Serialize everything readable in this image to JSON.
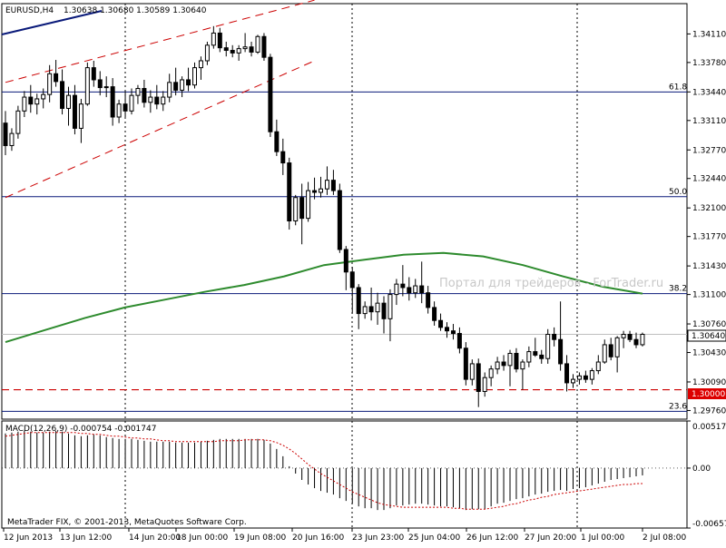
{
  "header": {
    "symbol_timeframe": "EURUSD,H4",
    "ohlc": "1.30638 1.30680 1.30589 1.30640"
  },
  "colors": {
    "background": "#ffffff",
    "grid": "#000000",
    "bull_candle": "#ffffff",
    "bear_candle": "#000000",
    "moving_average": "#2e8b2e",
    "trend_lines": "#cc0000",
    "support_line": "#cc0000",
    "trendline_upper": "#0a1a7a",
    "current_price_label_bg": "#ffffff",
    "level_label_bg": "#dd0000",
    "macd_signal": "#cc0000"
  },
  "watermark": "Портал для трейдеров - ForTrader.ru",
  "copyright": "MetaTrader FIX, © 2001-2013, MetaQuotes Software Corp.",
  "current_price_label": "1.30640",
  "support_level_label": "1.30000",
  "chart_data": [
    {
      "type": "candlestick",
      "title": "EURUSD,H4",
      "y_axis_ticks": [
        "1.34110",
        "1.33780",
        "1.33440",
        "1.33110",
        "1.32770",
        "1.32440",
        "1.32100",
        "1.31770",
        "1.31430",
        "1.31100",
        "1.30760",
        "1.30430",
        "1.30090",
        "1.29760"
      ],
      "ylim": [
        1.2966,
        1.3446
      ],
      "x_axis_ticks": [
        "12 Jun 2013",
        "13 Jun 12:00",
        "14 Jun 20:00",
        "18 Jun 00:00",
        "19 Jun 08:00",
        "20 Jun 16:00",
        "23 Jun 23:00",
        "25 Jun 04:00",
        "26 Jun 12:00",
        "27 Jun 20:00",
        "1 Jul 00:00",
        "2 Jul 08:00"
      ],
      "fibonacci_levels": [
        {
          "label": "61.8",
          "value": 1.3344
        },
        {
          "label": "50.0",
          "value": 1.3223
        },
        {
          "label": "38.2",
          "value": 1.3111
        },
        {
          "label": "23.6",
          "value": 1.2975
        }
      ],
      "horizontal_levels": [
        1.3,
        1.3064
      ],
      "candles": [
        [
          1.3308,
          1.3322,
          1.3271,
          1.3282
        ],
        [
          1.3282,
          1.3302,
          1.3276,
          1.3296
        ],
        [
          1.3296,
          1.3328,
          1.329,
          1.3322
        ],
        [
          1.3322,
          1.3345,
          1.3315,
          1.3338
        ],
        [
          1.3338,
          1.3352,
          1.332,
          1.333
        ],
        [
          1.333,
          1.3342,
          1.3318,
          1.3336
        ],
        [
          1.3336,
          1.3348,
          1.3325,
          1.3341
        ],
        [
          1.3341,
          1.3375,
          1.3332,
          1.3365
        ],
        [
          1.3365,
          1.3381,
          1.335,
          1.3356
        ],
        [
          1.3356,
          1.337,
          1.3318,
          1.3325
        ],
        [
          1.3325,
          1.335,
          1.3305,
          1.334
        ],
        [
          1.334,
          1.3352,
          1.3295,
          1.3302
        ],
        [
          1.3302,
          1.3336,
          1.3285,
          1.333
        ],
        [
          1.333,
          1.3378,
          1.3328,
          1.3372
        ],
        [
          1.3372,
          1.338,
          1.335,
          1.3358
        ],
        [
          1.3358,
          1.3368,
          1.334,
          1.3349
        ],
        [
          1.3349,
          1.3362,
          1.3338,
          1.335
        ],
        [
          1.335,
          1.336,
          1.3305,
          1.3315
        ],
        [
          1.3315,
          1.3335,
          1.3308,
          1.333
        ],
        [
          1.333,
          1.3345,
          1.3315,
          1.3322
        ],
        [
          1.3322,
          1.3348,
          1.3318,
          1.334
        ],
        [
          1.334,
          1.3352,
          1.333,
          1.3348
        ],
        [
          1.3348,
          1.3358,
          1.3326,
          1.3332
        ],
        [
          1.3332,
          1.3346,
          1.332,
          1.3338
        ],
        [
          1.3338,
          1.3352,
          1.3324,
          1.333
        ],
        [
          1.333,
          1.3345,
          1.3322,
          1.3338
        ],
        [
          1.3338,
          1.3365,
          1.3332,
          1.3355
        ],
        [
          1.3355,
          1.3372,
          1.334,
          1.3346
        ],
        [
          1.3346,
          1.3362,
          1.3338,
          1.3358
        ],
        [
          1.3358,
          1.3372,
          1.3345,
          1.3352
        ],
        [
          1.3352,
          1.3378,
          1.3348,
          1.3372
        ],
        [
          1.3372,
          1.3385,
          1.3358,
          1.338
        ],
        [
          1.338,
          1.3402,
          1.3375,
          1.3398
        ],
        [
          1.3398,
          1.342,
          1.3394,
          1.3412
        ],
        [
          1.3412,
          1.3418,
          1.339,
          1.3395
        ],
        [
          1.3395,
          1.3402,
          1.3385,
          1.3392
        ],
        [
          1.3392,
          1.3398,
          1.3384,
          1.3389
        ],
        [
          1.3389,
          1.3398,
          1.338,
          1.3394
        ],
        [
          1.3394,
          1.3412,
          1.339,
          1.3396
        ],
        [
          1.3396,
          1.3402,
          1.3385,
          1.339
        ],
        [
          1.339,
          1.341,
          1.3388,
          1.3408
        ],
        [
          1.3408,
          1.3412,
          1.338,
          1.3384
        ],
        [
          1.3384,
          1.3388,
          1.3292,
          1.3298
        ],
        [
          1.3298,
          1.3312,
          1.327,
          1.3275
        ],
        [
          1.3275,
          1.329,
          1.3248,
          1.3262
        ],
        [
          1.3262,
          1.3268,
          1.3185,
          1.3195
        ],
        [
          1.3195,
          1.3225,
          1.319,
          1.3222
        ],
        [
          1.3222,
          1.3238,
          1.3168,
          1.3198
        ],
        [
          1.3198,
          1.324,
          1.3194,
          1.323
        ],
        [
          1.323,
          1.3245,
          1.322,
          1.3228
        ],
        [
          1.3228,
          1.3246,
          1.3222,
          1.3232
        ],
        [
          1.3232,
          1.3258,
          1.3225,
          1.3242
        ],
        [
          1.3242,
          1.3254,
          1.3225,
          1.323
        ],
        [
          1.323,
          1.3238,
          1.3158,
          1.3162
        ],
        [
          1.3162,
          1.3166,
          1.3115,
          1.3136
        ],
        [
          1.3136,
          1.3142,
          1.3088,
          1.3118
        ],
        [
          1.3118,
          1.3122,
          1.307,
          1.3088
        ],
        [
          1.3088,
          1.3102,
          1.3082,
          1.3096
        ],
        [
          1.3096,
          1.3118,
          1.308,
          1.309
        ],
        [
          1.309,
          1.3112,
          1.3075,
          1.31
        ],
        [
          1.31,
          1.3108,
          1.3065,
          1.3082
        ],
        [
          1.3082,
          1.3116,
          1.3056,
          1.311
        ],
        [
          1.311,
          1.3128,
          1.3098,
          1.3122
        ],
        [
          1.3122,
          1.3144,
          1.3108,
          1.3118
        ],
        [
          1.3118,
          1.313,
          1.3103,
          1.3112
        ],
        [
          1.3112,
          1.3128,
          1.3106,
          1.312
        ],
        [
          1.312,
          1.3148,
          1.31,
          1.3112
        ],
        [
          1.3112,
          1.312,
          1.3088,
          1.3095
        ],
        [
          1.3095,
          1.3102,
          1.3074,
          1.308
        ],
        [
          1.308,
          1.3088,
          1.3068,
          1.3072
        ],
        [
          1.3072,
          1.3078,
          1.306,
          1.3068
        ],
        [
          1.3068,
          1.3076,
          1.3058,
          1.3065
        ],
        [
          1.3065,
          1.3072,
          1.3042,
          1.3048
        ],
        [
          1.3048,
          1.3055,
          1.3005,
          1.3012
        ],
        [
          1.3012,
          1.3035,
          1.3005,
          1.303
        ],
        [
          1.303,
          1.3036,
          1.298,
          1.2998
        ],
        [
          1.2998,
          1.302,
          1.2992,
          1.3014
        ],
        [
          1.3014,
          1.3028,
          1.3004,
          1.3024
        ],
        [
          1.3024,
          1.3038,
          1.3018,
          1.3032
        ],
        [
          1.3032,
          1.304,
          1.3022,
          1.3028
        ],
        [
          1.3028,
          1.3046,
          1.3004,
          1.3042
        ],
        [
          1.3042,
          1.3048,
          1.302,
          1.3024
        ],
        [
          1.3024,
          1.3035,
          1.3,
          1.3032
        ],
        [
          1.3032,
          1.305,
          1.3026,
          1.3044
        ],
        [
          1.3044,
          1.306,
          1.3038,
          1.304
        ],
        [
          1.304,
          1.3046,
          1.303,
          1.3036
        ],
        [
          1.3036,
          1.307,
          1.303,
          1.3064
        ],
        [
          1.3064,
          1.3072,
          1.305,
          1.3058
        ],
        [
          1.3058,
          1.3102,
          1.3022,
          1.303
        ],
        [
          1.303,
          1.304,
          1.2998,
          1.3008
        ],
        [
          1.3008,
          1.3018,
          1.3002,
          1.3012
        ],
        [
          1.3012,
          1.302,
          1.3006,
          1.3016
        ],
        [
          1.3016,
          1.3022,
          1.3008,
          1.3012
        ],
        [
          1.3012,
          1.3025,
          1.3006,
          1.3022
        ],
        [
          1.3022,
          1.304,
          1.3018,
          1.3032
        ],
        [
          1.3032,
          1.3058,
          1.303,
          1.3052
        ],
        [
          1.3052,
          1.306,
          1.3034,
          1.3038
        ],
        [
          1.3038,
          1.3062,
          1.302,
          1.306
        ],
        [
          1.306,
          1.3068,
          1.3048,
          1.3064
        ],
        [
          1.3064,
          1.3068,
          1.3055,
          1.3058
        ],
        [
          1.3058,
          1.3066,
          1.3048,
          1.3052
        ],
        [
          1.3052,
          1.3066,
          1.305,
          1.3064
        ]
      ],
      "moving_average": {
        "start_index": 0,
        "values": [
          1.3055,
          1.3069,
          1.3083,
          1.3095,
          1.3104,
          1.3113,
          1.3121,
          1.3131,
          1.3144,
          1.315,
          1.3156,
          1.3158,
          1.3154,
          1.3144,
          1.3131,
          1.3119,
          1.3111
        ]
      },
      "trend_lines": [
        {
          "style": "dashed",
          "from": [
            0,
            1.3355
          ],
          "to": [
            49,
            1.345
          ]
        },
        {
          "style": "dashed",
          "from": [
            0,
            1.3222
          ],
          "to": [
            49,
            1.338
          ]
        }
      ]
    },
    {
      "type": "bar",
      "title": "MACD(12,26,9) -0.000754 -0.001747",
      "y_axis_ticks": [
        "0.005171",
        "0.00",
        "-0.006575"
      ],
      "ylim": [
        -0.006575,
        0.005171
      ],
      "series": [
        {
          "name": "MACD",
          "values": [
            0.0038,
            0.0039,
            0.004,
            0.0041,
            0.004,
            0.0039,
            0.0039,
            0.004,
            0.0041,
            0.004,
            0.0038,
            0.0036,
            0.0035,
            0.0036,
            0.0037,
            0.0036,
            0.0034,
            0.0033,
            0.0032,
            0.0032,
            0.0032,
            0.0031,
            0.003,
            0.0029,
            0.0029,
            0.0029,
            0.0029,
            0.0028,
            0.0028,
            0.0028,
            0.0028,
            0.0029,
            0.003,
            0.0031,
            0.0032,
            0.0032,
            0.0032,
            0.0032,
            0.0032,
            0.0032,
            0.0032,
            0.0031,
            0.0027,
            0.0021,
            0.0013,
            0.0002,
            -0.0006,
            -0.0013,
            -0.0018,
            -0.0022,
            -0.0025,
            -0.0027,
            -0.0029,
            -0.0033,
            -0.0036,
            -0.0039,
            -0.0042,
            -0.0044,
            -0.0044,
            -0.0046,
            -0.0046,
            -0.0044,
            -0.0041,
            -0.0041,
            -0.004,
            -0.0039,
            -0.0039,
            -0.004,
            -0.0041,
            -0.0042,
            -0.0042,
            -0.0043,
            -0.0044,
            -0.0046,
            -0.0045,
            -0.0045,
            -0.0045,
            -0.0042,
            -0.0039,
            -0.0038,
            -0.0036,
            -0.0034,
            -0.0033,
            -0.0031,
            -0.0029,
            -0.0028,
            -0.0026,
            -0.0025,
            -0.0024,
            -0.0025,
            -0.0023,
            -0.0022,
            -0.0021,
            -0.0019,
            -0.0017,
            -0.0015,
            -0.0013,
            -0.0012,
            -0.0011,
            -0.001,
            -0.0009,
            -0.0008
          ]
        },
        {
          "name": "Signal",
          "values": [
            0.0035,
            0.0036,
            0.0037,
            0.0038,
            0.0039,
            0.0039,
            0.0039,
            0.0039,
            0.0039,
            0.0039,
            0.0039,
            0.0039,
            0.0038,
            0.0038,
            0.0037,
            0.0037,
            0.0036,
            0.0035,
            0.0035,
            0.0034,
            0.0033,
            0.0033,
            0.0032,
            0.0032,
            0.0031,
            0.003,
            0.003,
            0.0029,
            0.0029,
            0.0029,
            0.0029,
            0.0029,
            0.0029,
            0.0029,
            0.003,
            0.003,
            0.003,
            0.003,
            0.0031,
            0.0031,
            0.0031,
            0.0031,
            0.003,
            0.0028,
            0.0025,
            0.0021,
            0.0016,
            0.001,
            0.0004,
            -0.0001,
            -0.0006,
            -0.001,
            -0.0014,
            -0.0018,
            -0.0022,
            -0.0026,
            -0.0029,
            -0.0032,
            -0.0035,
            -0.0038,
            -0.004,
            -0.0041,
            -0.0042,
            -0.0043,
            -0.0043,
            -0.0043,
            -0.0043,
            -0.0043,
            -0.0043,
            -0.0043,
            -0.0043,
            -0.0044,
            -0.0044,
            -0.0045,
            -0.0045,
            -0.0045,
            -0.0045,
            -0.0044,
            -0.0043,
            -0.0042,
            -0.004,
            -0.0039,
            -0.0037,
            -0.0035,
            -0.0034,
            -0.0032,
            -0.0031,
            -0.0029,
            -0.0028,
            -0.0027,
            -0.0026,
            -0.0025,
            -0.0024,
            -0.0023,
            -0.0022,
            -0.0021,
            -0.002,
            -0.0019,
            -0.0018,
            -0.0018,
            -0.0017,
            -0.0017
          ]
        }
      ]
    }
  ]
}
